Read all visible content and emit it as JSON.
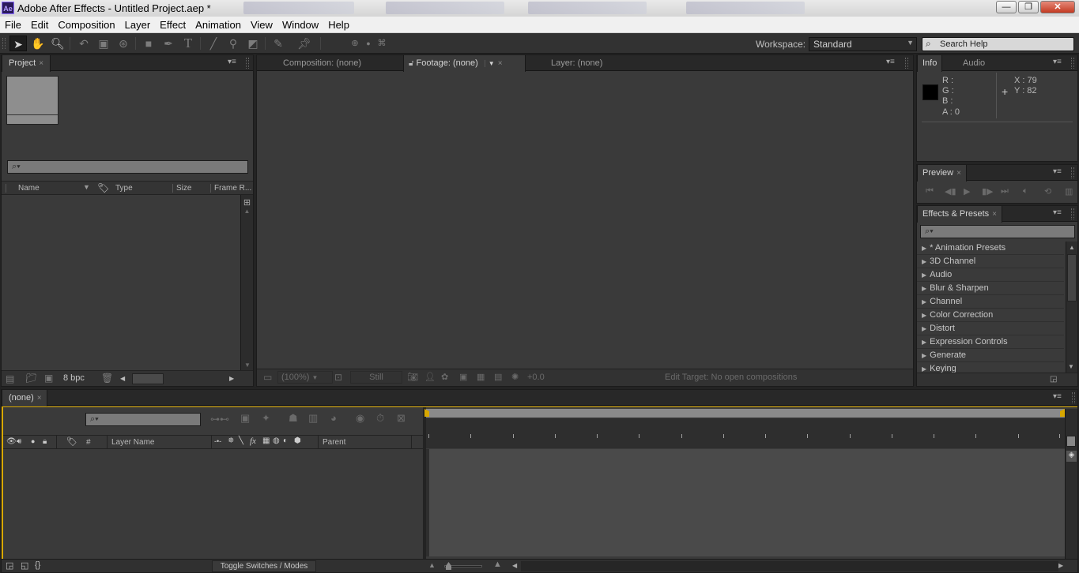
{
  "window": {
    "title": "Adobe After Effects - Untitled Project.aep *",
    "app_icon_text": "Ae",
    "buttons": {
      "minimize": "—",
      "maximize": "❐",
      "close": "✕"
    }
  },
  "menubar": [
    "File",
    "Edit",
    "Composition",
    "Layer",
    "Effect",
    "Animation",
    "View",
    "Window",
    "Help"
  ],
  "toolbar": {
    "tools": [
      "selection-tool",
      "hand-tool",
      "zoom-tool",
      "rotation-tool",
      "camera-tool",
      "pan-behind-tool",
      "rectangle-tool",
      "pen-tool",
      "text-tool",
      "brush-tool",
      "clone-stamp-tool",
      "eraser-tool",
      "roto-brush-tool",
      "puppet-pin-tool"
    ],
    "workspace_label": "Workspace:",
    "workspace_value": "Standard",
    "search_help_placeholder": "Search Help"
  },
  "project_panel": {
    "tab": "Project",
    "search_icon_text": "⌕▾",
    "columns": [
      "Name",
      "Type",
      "Size",
      "Frame R..."
    ],
    "bpc": "8 bpc"
  },
  "viewer": {
    "tabs": [
      "Composition: (none)",
      "Footage: (none)",
      "Layer: (none)"
    ],
    "zoom": "(100%)",
    "still": "Still",
    "exposure": "+0.0",
    "edit_target": "Edit Target: No open compositions"
  },
  "info_panel": {
    "tabs": [
      "Info",
      "Audio"
    ],
    "r": "R :",
    "g": "G :",
    "b": "B :",
    "a": "A : 0",
    "x": "X : 79",
    "y": "Y : 82",
    "swatch_color": "#000000"
  },
  "preview_panel": {
    "tab": "Preview"
  },
  "effects_panel": {
    "tab": "Effects & Presets",
    "search_icon_text": "⌕▾",
    "items": [
      "* Animation Presets",
      "3D Channel",
      "Audio",
      "Blur & Sharpen",
      "Channel",
      "Color Correction",
      "Distort",
      "Expression Controls",
      "Generate",
      "Keying"
    ]
  },
  "timeline": {
    "tab": "(none)",
    "search_icon_text": "⌕▾",
    "columns": {
      "hash": "#",
      "layer_name": "Layer Name",
      "parent": "Parent"
    },
    "toggle_label": "Toggle Switches / Modes"
  },
  "colors": {
    "accent_yellow": "#d8a800",
    "panel_bg": "#3a3a3a",
    "tabbar_bg": "#282828"
  }
}
